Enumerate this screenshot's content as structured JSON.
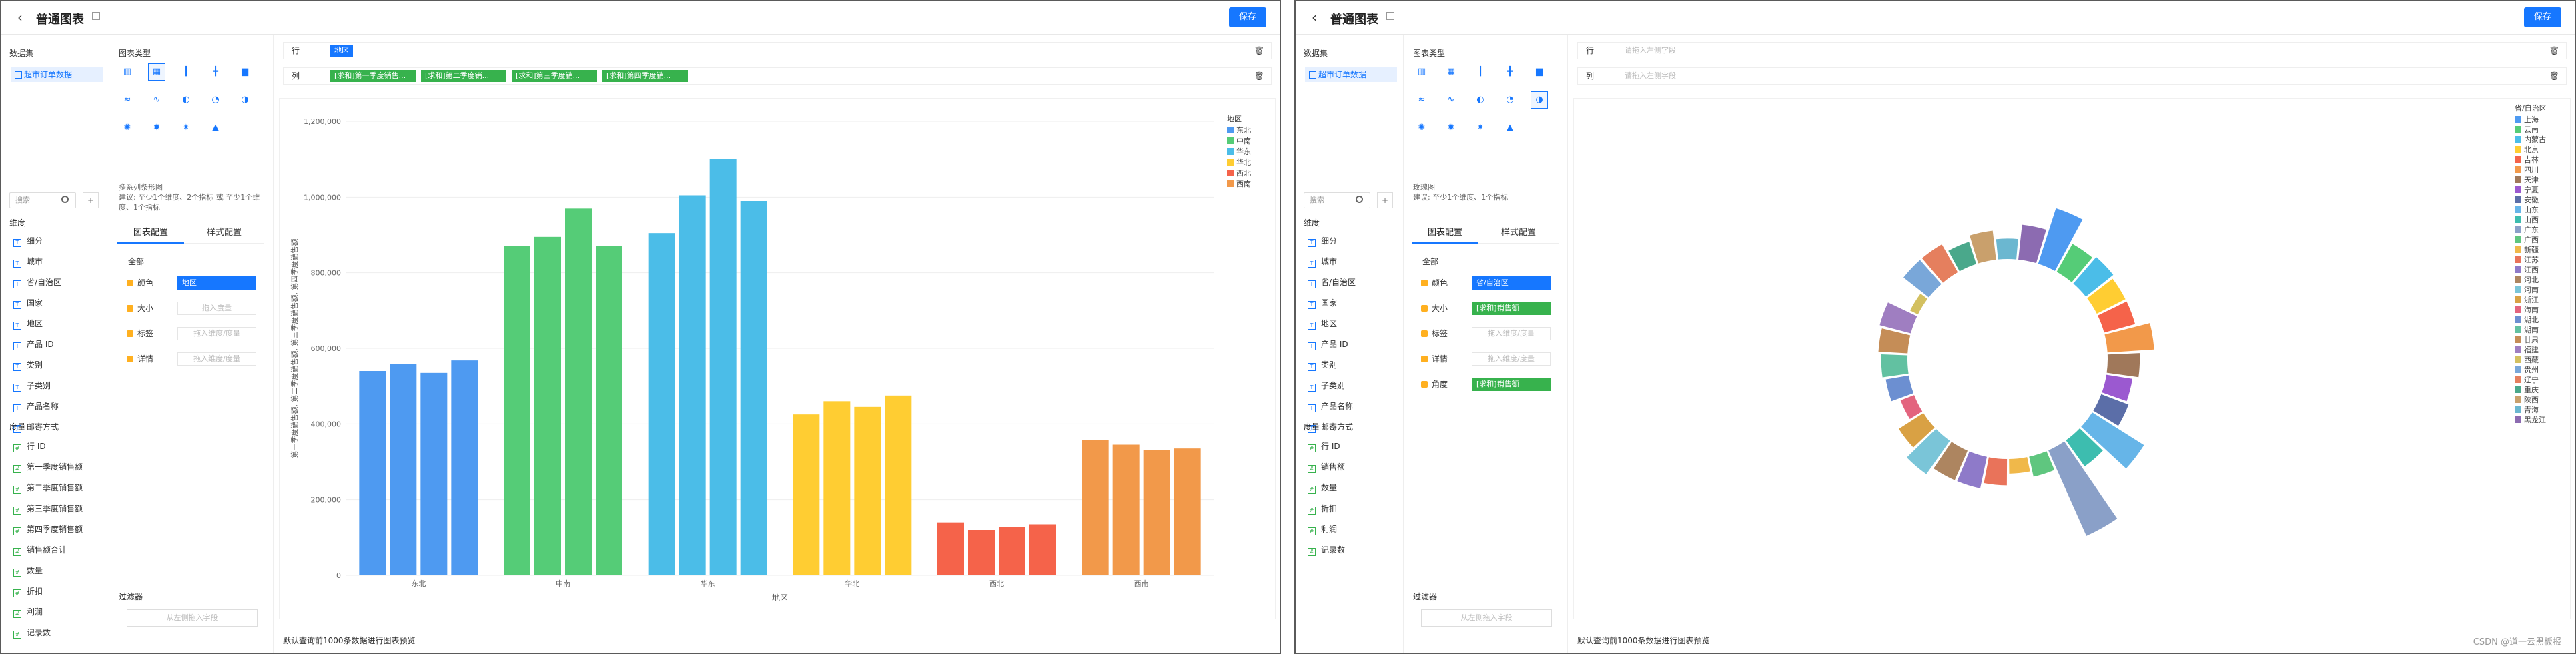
{
  "app": {
    "title": "普通图表",
    "save": "保存",
    "back": "‹"
  },
  "left": {
    "dataset_label": "数据集",
    "dataset_item": "超市订单数据",
    "search_placeholder": "搜索",
    "dim_label": "维度",
    "measure_label": "度量",
    "dims": [
      "细分",
      "城市",
      "省/自治区",
      "国家",
      "地区",
      "产品 ID",
      "类别",
      "子类别",
      "产品名称",
      "邮寄方式"
    ],
    "measures": [
      "行 ID",
      "第一季度销售额",
      "第二季度销售额",
      "第三季度销售额",
      "第四季度销售额",
      "销售额合计",
      "数量",
      "折扣",
      "利润",
      "记录数"
    ],
    "measures2": [
      "行 ID",
      "销售额",
      "数量",
      "折扣",
      "利润",
      "记录数"
    ]
  },
  "mid": {
    "chart_type_label": "图表类型",
    "desc1": "多系列条形图",
    "desc1b": "建议: 至少1个维度、2个指标 或 至少1个维度、1个指标",
    "desc2": "玫瑰图",
    "desc2b": "建议: 至少1个维度、1个指标",
    "tab_data": "图表配置",
    "tab_style": "样式配置",
    "all": "全部",
    "enc1": [
      {
        "k": "颜色",
        "v": "地区"
      },
      {
        "k": "大小",
        "v": "拖入度量"
      },
      {
        "k": "标签",
        "v": "拖入维度/度量"
      },
      {
        "k": "详情",
        "v": "拖入维度/度量"
      }
    ],
    "enc2": [
      {
        "k": "颜色",
        "v": "省/自治区"
      },
      {
        "k": "大小",
        "v": "[求和]销售额"
      },
      {
        "k": "标签",
        "v": "拖入维度/度量"
      },
      {
        "k": "详情",
        "v": "拖入维度/度量"
      },
      {
        "k": "角度",
        "v": "[求和]销售额"
      }
    ],
    "filter": "过滤器",
    "filter_placeholder": "从左侧拖入字段"
  },
  "shelves": {
    "row": "行",
    "col": "列",
    "row_pill": "地区",
    "col_pills": [
      "[求和]第一季度销售...",
      "[求和]第二季度销...",
      "[求和]第三季度销...",
      "[求和]第四季度销..."
    ],
    "row_ph": "请拖入左侧字段",
    "col_ph": "请拖入左侧字段"
  },
  "footer": "默认查询前1000条数据进行图表预览",
  "watermark": "CSDN @道一云黑板报",
  "colors": {
    "accent": "#1677ff",
    "green": "#37b24d"
  },
  "chart_data": [
    {
      "type": "bar",
      "categories": [
        "东北",
        "中南",
        "华东",
        "华北",
        "西北",
        "西南"
      ],
      "series": [
        {
          "name": "第一季度销售额",
          "values": [
            540000,
            870000,
            905000,
            425000,
            140000,
            358000
          ]
        },
        {
          "name": "第二季度销售额",
          "values": [
            558000,
            895000,
            1005000,
            460000,
            120000,
            345000
          ]
        },
        {
          "name": "第三季度销售额",
          "values": [
            535000,
            970000,
            1100000,
            445000,
            128000,
            330000
          ]
        },
        {
          "name": "第四季度销售额",
          "values": [
            568000,
            870000,
            990000,
            475000,
            135000,
            335000
          ]
        }
      ],
      "colors": [
        "#4e9af1",
        "#55cc77",
        "#4bbde8",
        "#ffcd32",
        "#f5634a",
        "#f2994a"
      ],
      "yticks": [
        "0",
        "200,000",
        "400,000",
        "600,000",
        "800,000",
        "1,000,000",
        "1,200,000"
      ],
      "ylim": [
        0,
        1200000
      ],
      "xlabel": "地区",
      "ylabel": "第一季度销售额, 第二季度销售额, 第三季度销售额, 第四季度销售额",
      "legend_title": "地区",
      "legend": [
        "东北",
        "中南",
        "华东",
        "华北",
        "西北",
        "西南"
      ]
    },
    {
      "type": "pie",
      "subtype": "rose",
      "legend_title": "省/自治区",
      "categories": [
        "上海",
        "云南",
        "内蒙古",
        "北京",
        "吉林",
        "四川",
        "天津",
        "宁夏",
        "安徽",
        "山东",
        "山西",
        "广东",
        "广西",
        "新疆",
        "江苏",
        "江西",
        "河北",
        "河南",
        "浙江",
        "海南",
        "湖北",
        "湖南",
        "甘肃",
        "福建",
        "西藏",
        "贵州",
        "辽宁",
        "重庆",
        "陕西",
        "青海",
        "黑龙江"
      ],
      "values": [
        100,
        55,
        60,
        55,
        55,
        80,
        55,
        45,
        50,
        105,
        55,
        160,
        35,
        25,
        45,
        55,
        55,
        70,
        50,
        25,
        40,
        45,
        50,
        55,
        15,
        55,
        55,
        40,
        50,
        35,
        60
      ],
      "colors": [
        "#4e9af1",
        "#55cc77",
        "#4bbde8",
        "#ffcd32",
        "#f5634a",
        "#f2994a",
        "#a0785a",
        "#9b59d0",
        "#5b6ea8",
        "#66b5e8",
        "#3dbdaf",
        "#8aa0c8",
        "#5fc67f",
        "#f0b84a",
        "#e9735a",
        "#8e7ac9",
        "#ad8560",
        "#7ac5d8",
        "#d9a144",
        "#e3647e",
        "#6c8fd1",
        "#62c1a1",
        "#c58d57",
        "#9f7ec1",
        "#d3c060",
        "#79a7d9",
        "#e57f5e",
        "#4aa88b",
        "#c9a06c",
        "#6bb7d0",
        "#8c6bb1"
      ]
    }
  ]
}
